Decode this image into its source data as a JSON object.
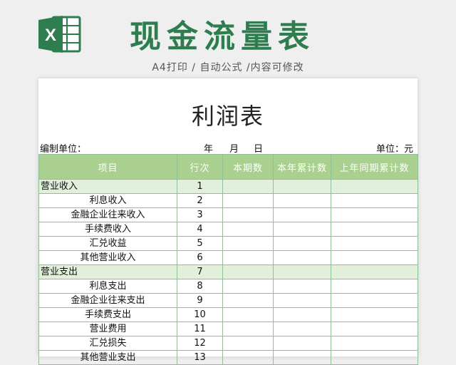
{
  "header": {
    "title": "现金流量表",
    "subtitle": "A4打印 / 自动公式 /内容可修改",
    "logo_icon": "excel-logo-icon",
    "accent_color": "#2e7d4f"
  },
  "report": {
    "title": "利润表",
    "org_label": "编制单位：",
    "year_label": "年",
    "month_label": "月",
    "day_label": "日",
    "unit_label": "单位：元"
  },
  "table": {
    "header_color": "#a9d08e",
    "group_row_color": "#e2efda",
    "columns": [
      "项目",
      "行次",
      "本期数",
      "本年累计数",
      "上年同期累计数"
    ],
    "rows": [
      {
        "item": "营业收入",
        "seq": "1",
        "group": true
      },
      {
        "item": "利息收入",
        "seq": "2",
        "group": false
      },
      {
        "item": "金融企业往来收入",
        "seq": "3",
        "group": false
      },
      {
        "item": "手续费收入",
        "seq": "4",
        "group": false
      },
      {
        "item": "汇兑收益",
        "seq": "5",
        "group": false
      },
      {
        "item": "其他营业收入",
        "seq": "6",
        "group": false
      },
      {
        "item": "营业支出",
        "seq": "7",
        "group": true
      },
      {
        "item": "利息支出",
        "seq": "8",
        "group": false
      },
      {
        "item": "金融企业往来支出",
        "seq": "9",
        "group": false
      },
      {
        "item": "手续费支出",
        "seq": "10",
        "group": false
      },
      {
        "item": "营业费用",
        "seq": "11",
        "group": false
      },
      {
        "item": "汇兑损失",
        "seq": "12",
        "group": false
      },
      {
        "item": "其他营业支出",
        "seq": "13",
        "group": false
      }
    ]
  }
}
